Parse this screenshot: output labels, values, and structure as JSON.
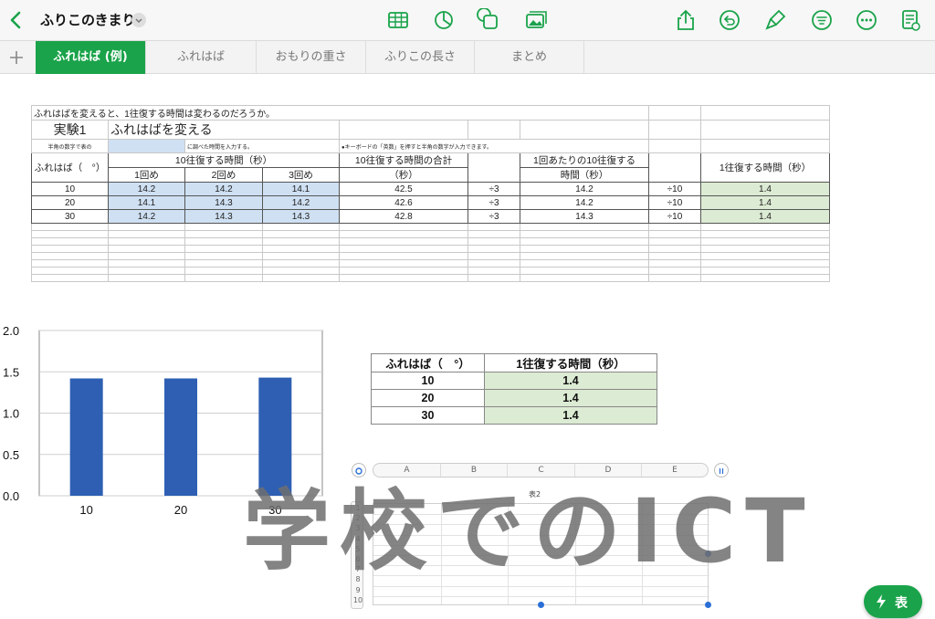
{
  "header": {
    "doc_title": "ふりこのきまり",
    "icons": [
      "table-icon",
      "chart-icon",
      "shape-icon",
      "media-icon",
      "share-icon",
      "undo-icon",
      "format-brush-icon",
      "filter-icon",
      "more-icon",
      "document-settings-icon"
    ]
  },
  "tabs": [
    {
      "label": "ふれはば (例)",
      "active": true
    },
    {
      "label": "ふれはば"
    },
    {
      "label": "おもりの重さ"
    },
    {
      "label": "ふりこの長さ"
    },
    {
      "label": "まとめ"
    }
  ],
  "sheet": {
    "question": "ふれはばを変えると、1往復する時間は変わるのだろうか。",
    "experiment": "実験1",
    "experiment_title": "ふれはばを変える",
    "note_left": "半角の数字で表の",
    "note_mid": "に調べた時間を入力する。",
    "note_right": "●キーボードの「英数」を押すと半角の数字が入力できます。",
    "h_amplitude": "ふれはば（　°）",
    "h_ten_times": "10往復する時間（秒）",
    "h_trial1": "1回め",
    "h_trial2": "2回め",
    "h_trial3": "3回め",
    "h_total_1": "10往復する時間の合計",
    "h_total_2": "（秒）",
    "h_avg_1": "1回あたりの10往復する",
    "h_avg_2": "時間（秒）",
    "h_one": "1往復する時間（秒）",
    "rows": [
      {
        "amp": "10",
        "t1": "14.2",
        "t2": "14.2",
        "t3": "14.1",
        "total": "42.5",
        "div3": "÷3",
        "avg": "14.2",
        "div10": "÷10",
        "one": "1.4"
      },
      {
        "amp": "20",
        "t1": "14.1",
        "t2": "14.3",
        "t3": "14.2",
        "total": "42.6",
        "div3": "÷3",
        "avg": "14.2",
        "div10": "÷10",
        "one": "1.4"
      },
      {
        "amp": "30",
        "t1": "14.2",
        "t2": "14.3",
        "t3": "14.3",
        "total": "42.8",
        "div3": "÷3",
        "avg": "14.3",
        "div10": "÷10",
        "one": "1.4"
      }
    ]
  },
  "chart_data": {
    "type": "bar",
    "categories": [
      "10",
      "20",
      "30"
    ],
    "values": [
      1.42,
      1.42,
      1.43
    ],
    "ylim": [
      0,
      2.0
    ],
    "yticks": [
      "0.0",
      "0.5",
      "1.0",
      "1.5",
      "2.0"
    ],
    "grid": true,
    "bar_color": "#2e5fb3"
  },
  "summary": {
    "h_amplitude": "ふれはば（　°）",
    "h_one": "1往復する時間（秒）",
    "rows": [
      {
        "amp": "10",
        "one": "1.4"
      },
      {
        "amp": "20",
        "one": "1.4"
      },
      {
        "amp": "30",
        "one": "1.4"
      }
    ]
  },
  "table2": {
    "name": "表2",
    "columns": [
      "A",
      "B",
      "C",
      "D",
      "E"
    ],
    "row_numbers": [
      "1",
      "2",
      "3",
      "4",
      "5",
      "6",
      "7",
      "8",
      "9",
      "10"
    ]
  },
  "watermark": "学校でのICT",
  "fab": {
    "label": "表"
  },
  "colors": {
    "accent": "#1aa34a",
    "input_blue": "#cfe0f3",
    "result_green": "#dcebd3",
    "selection": "#2a6fd6"
  }
}
